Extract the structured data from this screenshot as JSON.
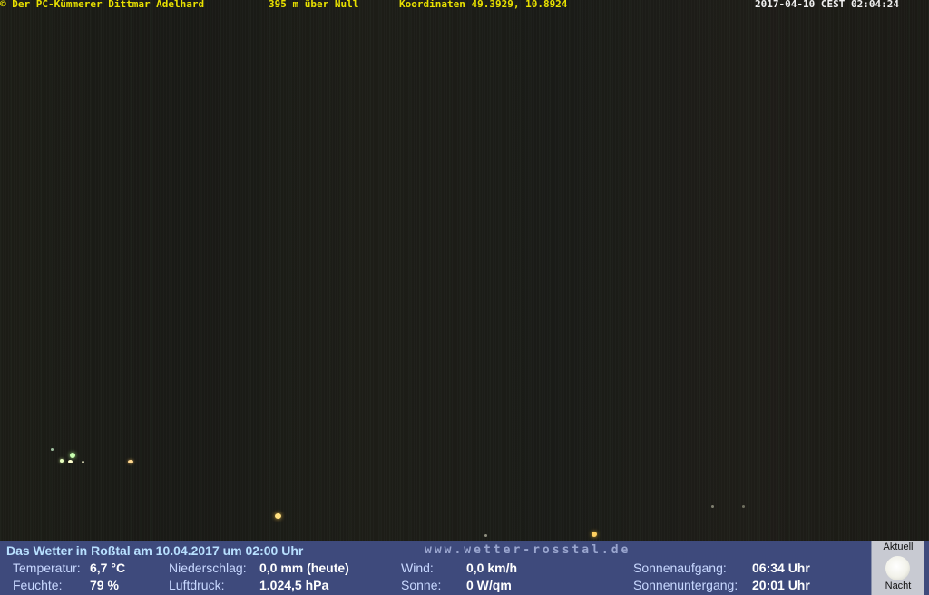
{
  "overlay": {
    "credit": "© Der PC-Kümmerer Dittmar Adelhard",
    "altitude": "395 m über Null",
    "coordinates": "Koordinaten 49.3929, 10.8924",
    "timestamp": "2017-04-10 CEST 02:04:24"
  },
  "weather": {
    "headline": "Das Wetter in Roßtal am 10.04.2017 um 02:00 Uhr",
    "url": "www.wetter-rosstal.de",
    "temperature_label": "Temperatur:",
    "temperature_value": "6,7 °C",
    "humidity_label": "Feuchte:",
    "humidity_value": "79 %",
    "precip_label": "Niederschlag:",
    "precip_value": "0,0 mm (heute)",
    "pressure_label": "Luftdruck:",
    "pressure_value": "1.024,5 hPa",
    "wind_label": "Wind:",
    "wind_value": "0,0 km/h",
    "sun_label": "Sonne:",
    "sun_value": "0 W/qm",
    "sunrise_label": "Sonnenaufgang:",
    "sunrise_value": "06:34 Uhr",
    "sunset_label": "Sonnenuntergang:",
    "sunset_value": "20:01 Uhr"
  },
  "moon": {
    "top_label": "Aktuell",
    "bottom_label": "Nacht",
    "icon": "full-moon-icon"
  }
}
